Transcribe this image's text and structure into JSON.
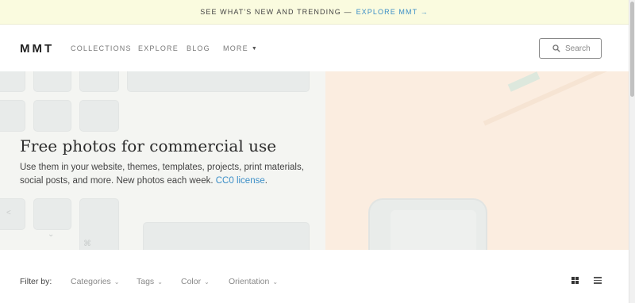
{
  "announcement": {
    "text": "SEE WHAT'S NEW AND TRENDING —",
    "link": "EXPLORE MMT →"
  },
  "header": {
    "logo": "MMT",
    "nav": {
      "collections": "COLLECTIONS",
      "explore": "EXPLORE",
      "blog": "BLOG",
      "more": "MORE"
    },
    "search_label": "Search"
  },
  "hero": {
    "title": "Free photos for commercial use",
    "description": "Use them in your website, themes, templates, projects, print materials, social posts, and more. New photos each week.",
    "license_link": "CC0 license",
    "period": ".",
    "keyboard_label": "command"
  },
  "filters": {
    "label": "Filter by:",
    "categories": "Categories",
    "tags": "Tags",
    "color": "Color",
    "orientation": "Orientation"
  },
  "colors": {
    "accent": "#3b8ec7",
    "announcement_bg": "#fafbdf"
  },
  "icons": {
    "search": "search-icon",
    "more_caret": "caret-down-icon",
    "grid_view": "grid-view-icon",
    "list_view": "list-view-icon"
  }
}
